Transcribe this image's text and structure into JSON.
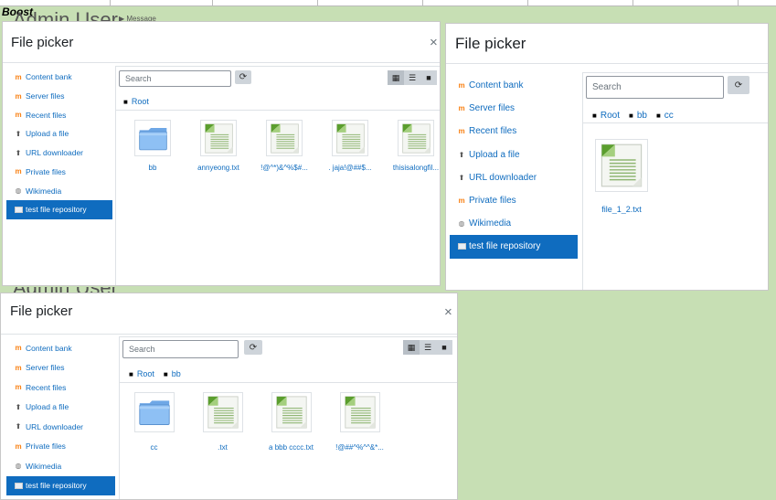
{
  "app": {
    "label": "Boost",
    "bg_text_top": "Admin User",
    "bg_text_mid": "Admin User",
    "bg_msg": "Message"
  },
  "colors": {
    "accent": "#0f6cbf",
    "background": "#c7dfb4"
  },
  "dialogs": [
    {
      "title": "File picker",
      "close": "×",
      "sidebar": [
        {
          "label": "Content bank",
          "icon": "moodle-icon"
        },
        {
          "label": "Server files",
          "icon": "moodle-icon"
        },
        {
          "label": "Recent files",
          "icon": "moodle-icon"
        },
        {
          "label": "Upload a file",
          "icon": "upload-icon"
        },
        {
          "label": "URL downloader",
          "icon": "upload-icon"
        },
        {
          "label": "Private files",
          "icon": "moodle-icon"
        },
        {
          "label": "Wikimedia",
          "icon": "wiki-icon"
        },
        {
          "label": "test file repository",
          "icon": "repo-icon",
          "active": true
        }
      ],
      "search_placeholder": "Search",
      "breadcrumb": [
        "Root"
      ],
      "files": [
        {
          "name": "bb",
          "type": "folder"
        },
        {
          "name": "annyeong.txt",
          "type": "file"
        },
        {
          "name": "!@^*)&^%$#...",
          "type": "file"
        },
        {
          "name": ". jaja!@##$...",
          "type": "file"
        },
        {
          "name": "thisisalongfil...",
          "type": "file"
        }
      ]
    },
    {
      "title": "File picker",
      "close": "",
      "sidebar": [
        {
          "label": "Content bank",
          "icon": "moodle-icon"
        },
        {
          "label": "Server files",
          "icon": "moodle-icon"
        },
        {
          "label": "Recent files",
          "icon": "moodle-icon"
        },
        {
          "label": "Upload a file",
          "icon": "upload-icon"
        },
        {
          "label": "URL downloader",
          "icon": "upload-icon"
        },
        {
          "label": "Private files",
          "icon": "moodle-icon"
        },
        {
          "label": "Wikimedia",
          "icon": "wiki-icon"
        },
        {
          "label": "test file repository",
          "icon": "repo-icon",
          "active": true
        }
      ],
      "search_placeholder": "Search",
      "breadcrumb": [
        "Root",
        "bb",
        "cc"
      ],
      "files": [
        {
          "name": "file_1_2.txt",
          "type": "file"
        }
      ]
    },
    {
      "title": "File picker",
      "close": "×",
      "sidebar": [
        {
          "label": "Content bank",
          "icon": "moodle-icon"
        },
        {
          "label": "Server files",
          "icon": "moodle-icon"
        },
        {
          "label": "Recent files",
          "icon": "moodle-icon"
        },
        {
          "label": "Upload a file",
          "icon": "upload-icon"
        },
        {
          "label": "URL downloader",
          "icon": "upload-icon"
        },
        {
          "label": "Private files",
          "icon": "moodle-icon"
        },
        {
          "label": "Wikimedia",
          "icon": "wiki-icon"
        },
        {
          "label": "test file repository",
          "icon": "repo-icon",
          "active": true
        }
      ],
      "search_placeholder": "Search",
      "breadcrumb": [
        "Root",
        "bb"
      ],
      "files": [
        {
          "name": "cc",
          "type": "folder"
        },
        {
          "name": ".txt",
          "type": "file"
        },
        {
          "name": "a bbb cccc.txt",
          "type": "file"
        },
        {
          "name": "!@##^%^^&*...",
          "type": "file"
        }
      ]
    }
  ]
}
